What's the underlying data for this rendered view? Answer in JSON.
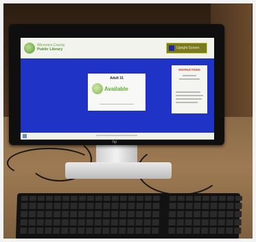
{
  "screen": {
    "logo": {
      "line1": "Wicomico County",
      "line2": "Public Library"
    },
    "upright_button": "Upright Screen",
    "card": {
      "title": "Adult 31",
      "status": "Available"
    },
    "instructions_title": "INSTRUCTIONS"
  },
  "colors": {
    "screen_background": "#1f33c6",
    "available_text": "#5fae32",
    "instructions_title": "#c43b2a",
    "upright_button": "#7a7b20"
  }
}
